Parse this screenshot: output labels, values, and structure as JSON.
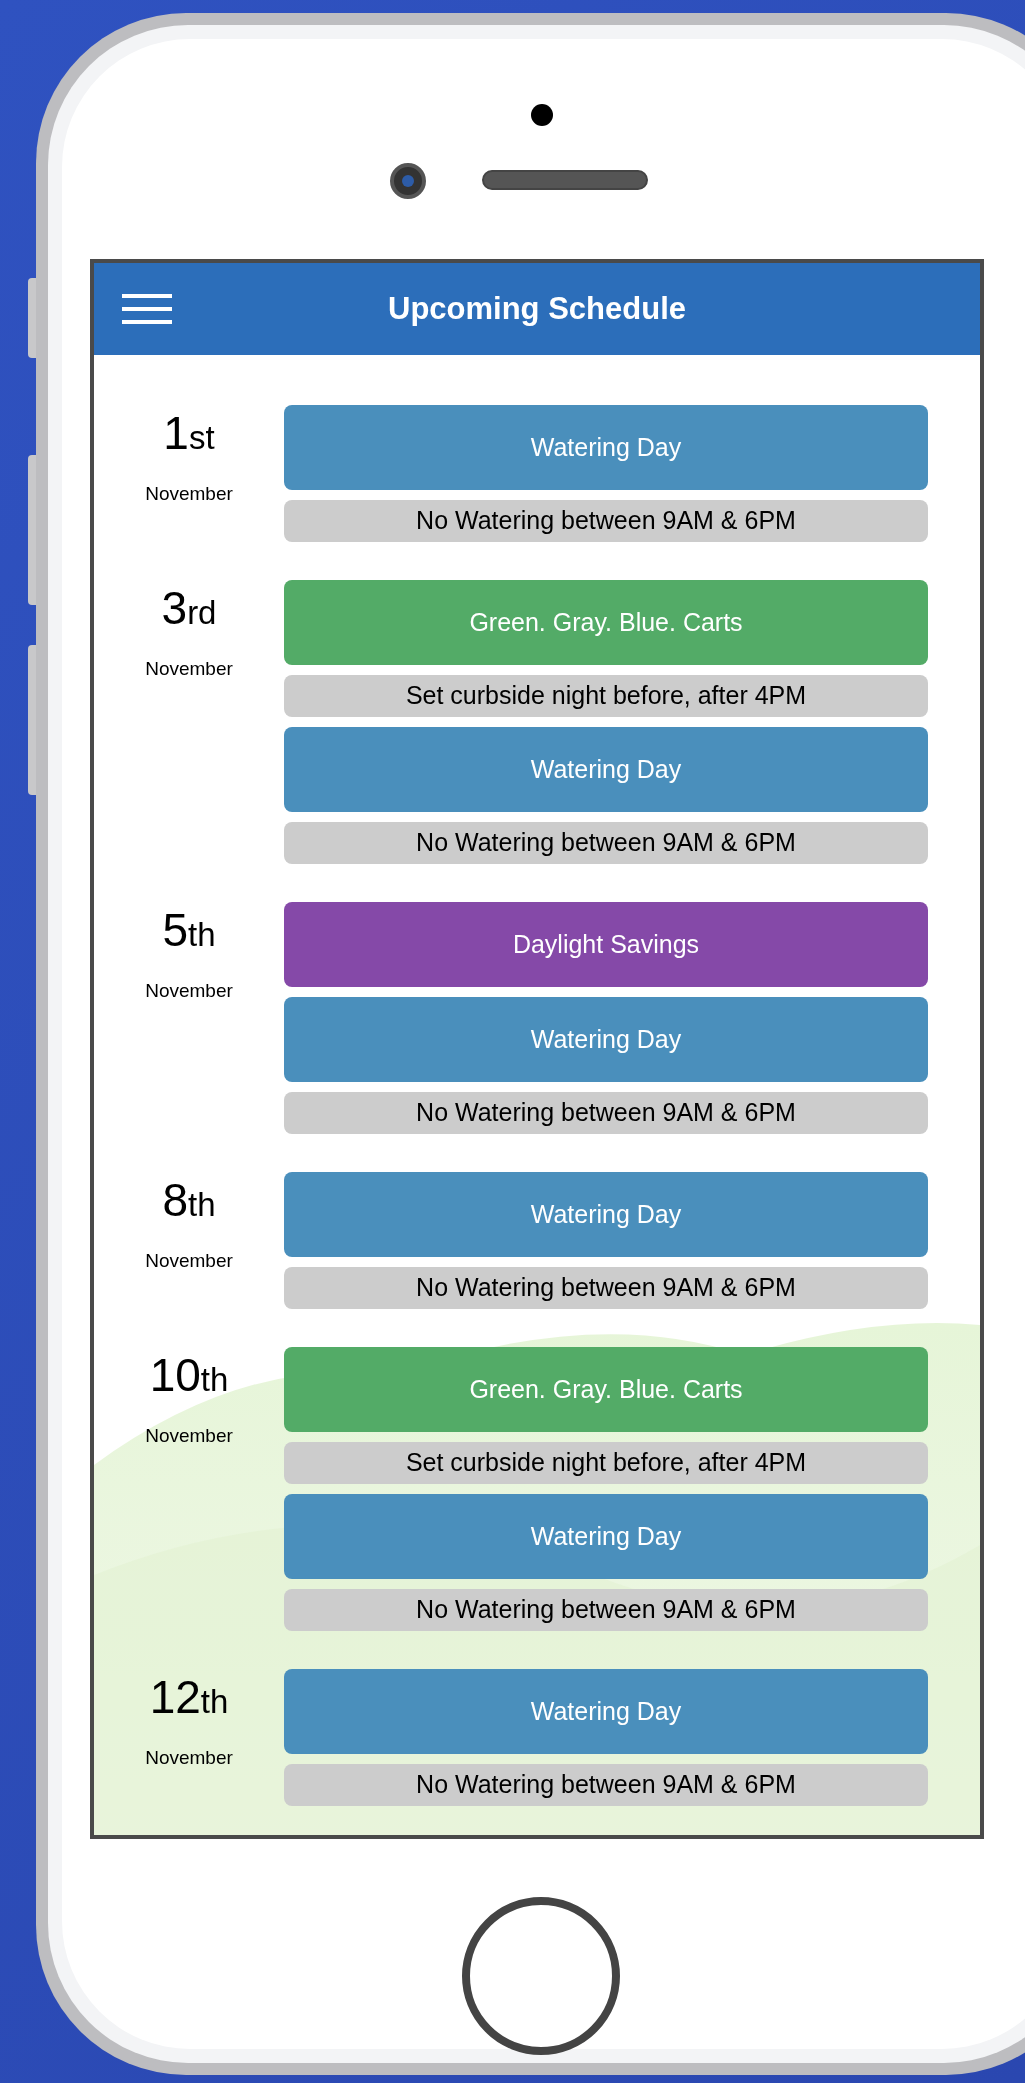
{
  "header": {
    "title": "Upcoming Schedule"
  },
  "days": [
    {
      "number": "1",
      "suffix": "st",
      "month": "November",
      "events": [
        {
          "kind": "watering",
          "label": "Watering Day",
          "note": "No Watering between 9AM & 6PM"
        }
      ]
    },
    {
      "number": "3",
      "suffix": "rd",
      "month": "November",
      "events": [
        {
          "kind": "carts",
          "label": "Green. Gray. Blue. Carts",
          "note": "Set curbside night before, after 4PM"
        },
        {
          "kind": "watering",
          "label": "Watering Day",
          "note": "No Watering between 9AM & 6PM"
        }
      ]
    },
    {
      "number": "5",
      "suffix": "th",
      "month": "November",
      "events": [
        {
          "kind": "daylight",
          "label": "Daylight Savings"
        },
        {
          "kind": "watering",
          "label": "Watering Day",
          "note": "No Watering between 9AM & 6PM"
        }
      ]
    },
    {
      "number": "8",
      "suffix": "th",
      "month": "November",
      "events": [
        {
          "kind": "watering",
          "label": "Watering Day",
          "note": "No Watering between 9AM & 6PM"
        }
      ]
    },
    {
      "number": "10",
      "suffix": "th",
      "month": "November",
      "events": [
        {
          "kind": "carts",
          "label": "Green. Gray. Blue. Carts",
          "note": "Set curbside night before, after 4PM"
        },
        {
          "kind": "watering",
          "label": "Watering Day",
          "note": "No Watering between 9AM & 6PM"
        }
      ]
    },
    {
      "number": "12",
      "suffix": "th",
      "month": "November",
      "events": [
        {
          "kind": "watering",
          "label": "Watering Day",
          "note": "No Watering between 9AM & 6PM"
        }
      ]
    }
  ]
}
